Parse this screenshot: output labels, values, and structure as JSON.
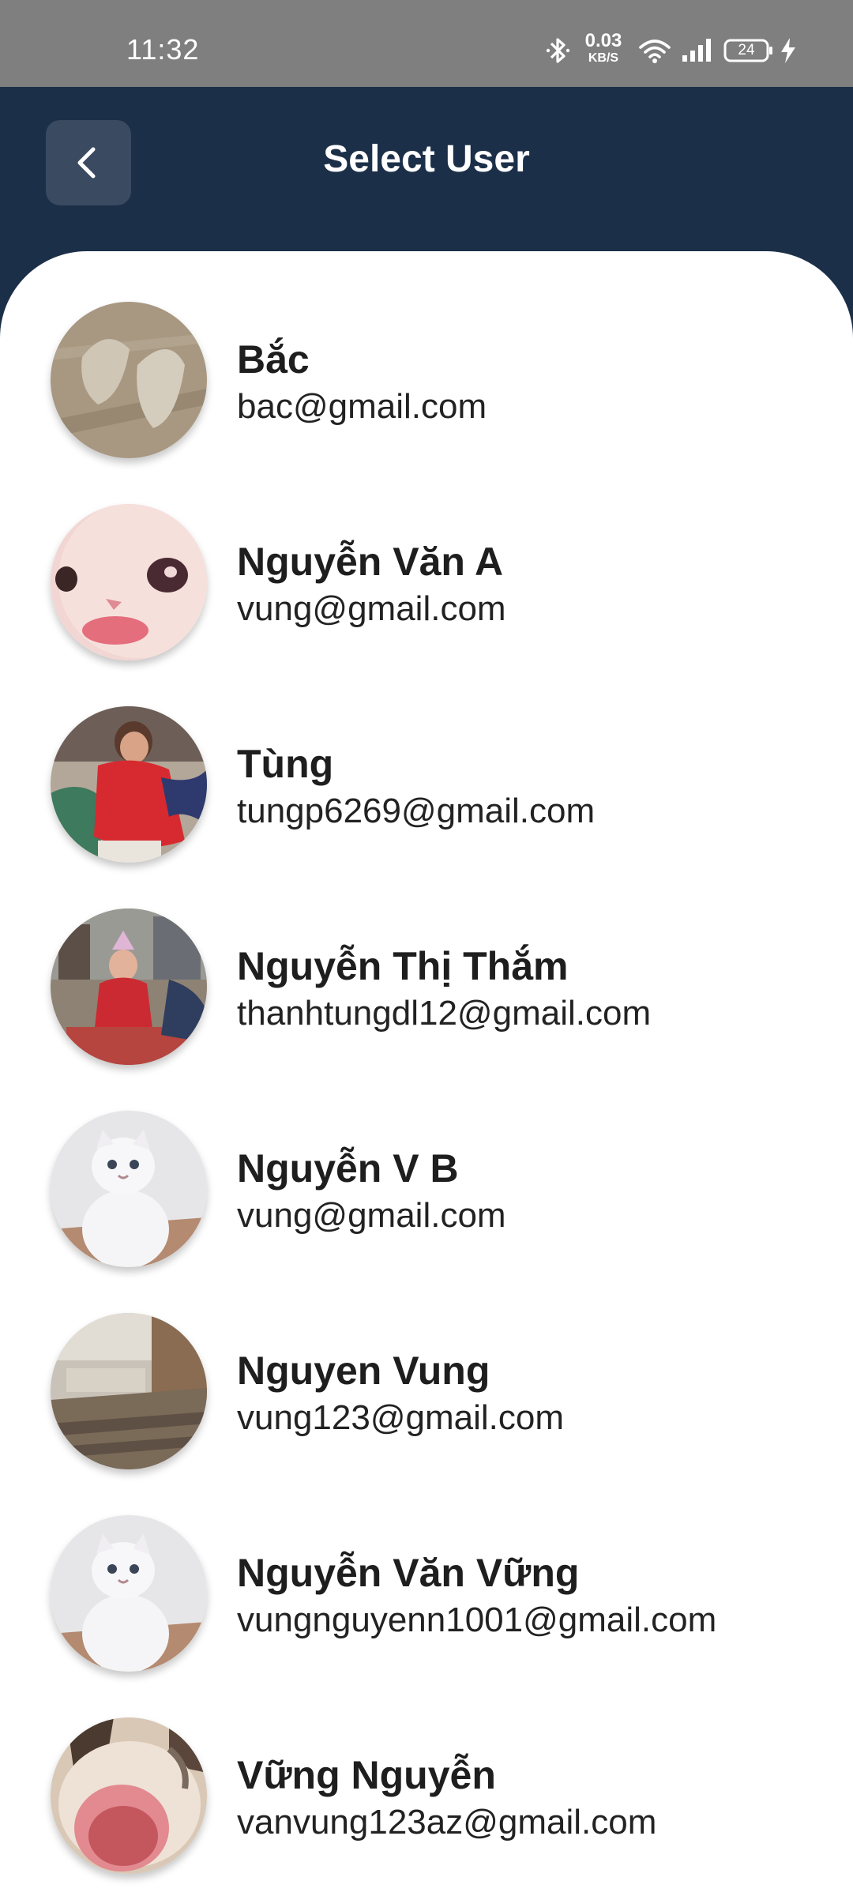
{
  "status_bar": {
    "time": "11:32",
    "net_speed_value": "0.03",
    "net_speed_unit": "KB/S",
    "battery": "24",
    "icons": [
      "bluetooth-icon",
      "wifi-icon",
      "signal-icon",
      "battery-icon",
      "charging-icon"
    ]
  },
  "header": {
    "title": "Select User",
    "back_icon": "chevron-left-icon",
    "background": "#1b2f48"
  },
  "users": [
    {
      "name": "Bắc",
      "email": "bac@gmail.com"
    },
    {
      "name": "Nguyễn Văn A",
      "email": "vung@gmail.com"
    },
    {
      "name": "Tùng",
      "email": "tungp6269@gmail.com"
    },
    {
      "name": "Nguyễn Thị Thắm",
      "email": "thanhtungdl12@gmail.com"
    },
    {
      "name": "Nguyễn V B",
      "email": "vung@gmail.com"
    },
    {
      "name": "Nguyen Vung",
      "email": "vung123@gmail.com"
    },
    {
      "name": "Nguyễn Văn Vững",
      "email": "vungnguyenn1001@gmail.com"
    },
    {
      "name": "Vững Nguyễn",
      "email": "vanvung123az@gmail.com"
    }
  ]
}
